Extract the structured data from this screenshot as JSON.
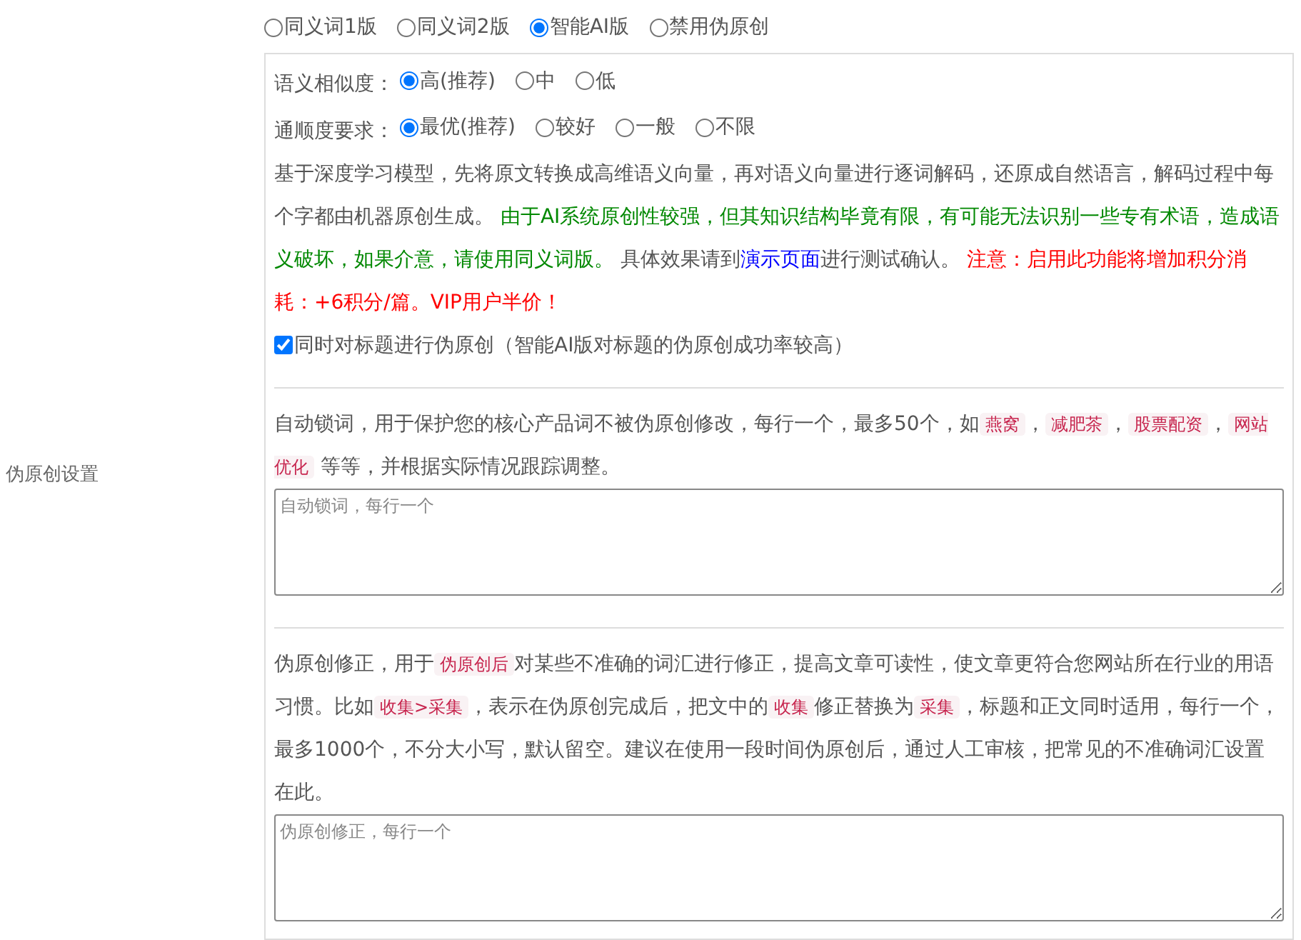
{
  "setting_label": "伪原创设置",
  "modes": [
    {
      "label": "同义词1版",
      "selected": false
    },
    {
      "label": "同义词2版",
      "selected": false
    },
    {
      "label": "智能AI版",
      "selected": true
    },
    {
      "label": "禁用伪原创",
      "selected": false
    }
  ],
  "similarity": {
    "label": "语义相似度：",
    "options": [
      {
        "label": "高(推荐)",
        "selected": true
      },
      {
        "label": "中",
        "selected": false
      },
      {
        "label": "低",
        "selected": false
      }
    ]
  },
  "fluency": {
    "label": "通顺度要求：",
    "options": [
      {
        "label": "最优(推荐)",
        "selected": true
      },
      {
        "label": "较好",
        "selected": false
      },
      {
        "label": "一般",
        "selected": false
      },
      {
        "label": "不限",
        "selected": false
      }
    ]
  },
  "ai_description": [
    {
      "kind": "plain",
      "text": "基于深度学习模型，先将原文转换成高维语义向量，再对语义向量进行逐词解码，还原成自然语言，解码过程中每个字都由机器原创生成。 "
    },
    {
      "kind": "green",
      "text": "由于AI系统原创性较强，但其知识结构毕竟有限，有可能无法识别一些专有术语，造成语义破坏，如果介意，请使用同义词版。"
    },
    {
      "kind": "plain",
      "text": " 具体效果请到"
    },
    {
      "kind": "link",
      "text": "演示页面"
    },
    {
      "kind": "plain",
      "text": "进行测试确认。 "
    },
    {
      "kind": "red",
      "text": "注意：启用此功能将增加积分消耗：+6积分/篇。VIP用户半价！"
    }
  ],
  "title_option": {
    "label": "同时对标题进行伪原创（智能AI版对标题的伪原创成功率较高）",
    "checked": true
  },
  "lock_description": [
    {
      "kind": "plain",
      "text": "自动锁词，用于保护您的核心产品词不被伪原创修改，每行一个，最多50个，如"
    },
    {
      "kind": "code",
      "text": "燕窝"
    },
    {
      "kind": "plain",
      "text": "，"
    },
    {
      "kind": "code",
      "text": "减肥茶"
    },
    {
      "kind": "plain",
      "text": "，"
    },
    {
      "kind": "code",
      "text": "股票配资"
    },
    {
      "kind": "plain",
      "text": "，"
    },
    {
      "kind": "code",
      "text": "网站优化"
    },
    {
      "kind": "plain",
      "text": " 等等，并根据实际情况跟踪调整。"
    }
  ],
  "lock_field": {
    "placeholder": "自动锁词，每行一个"
  },
  "correct_description": [
    {
      "kind": "plain",
      "text": "伪原创修正，用于"
    },
    {
      "kind": "code",
      "text": "伪原创后"
    },
    {
      "kind": "plain",
      "text": "对某些不准确的词汇进行修正，提高文章可读性，使文章更符合您网站所在行业的用语习惯。比如"
    },
    {
      "kind": "code",
      "text": "收集>采集"
    },
    {
      "kind": "plain",
      "text": "，表示在伪原创完成后，把文中的"
    },
    {
      "kind": "code",
      "text": "收集"
    },
    {
      "kind": "plain",
      "text": "修正替换为"
    },
    {
      "kind": "code",
      "text": "采集"
    },
    {
      "kind": "plain",
      "text": "，标题和正文同时适用，每行一个，最多1000个，不分大小写，默认留空。建议在使用一段时间伪原创后，通过人工审核，把常见的不准确词汇设置在此。"
    }
  ],
  "correct_field": {
    "placeholder": "伪原创修正，每行一个"
  }
}
